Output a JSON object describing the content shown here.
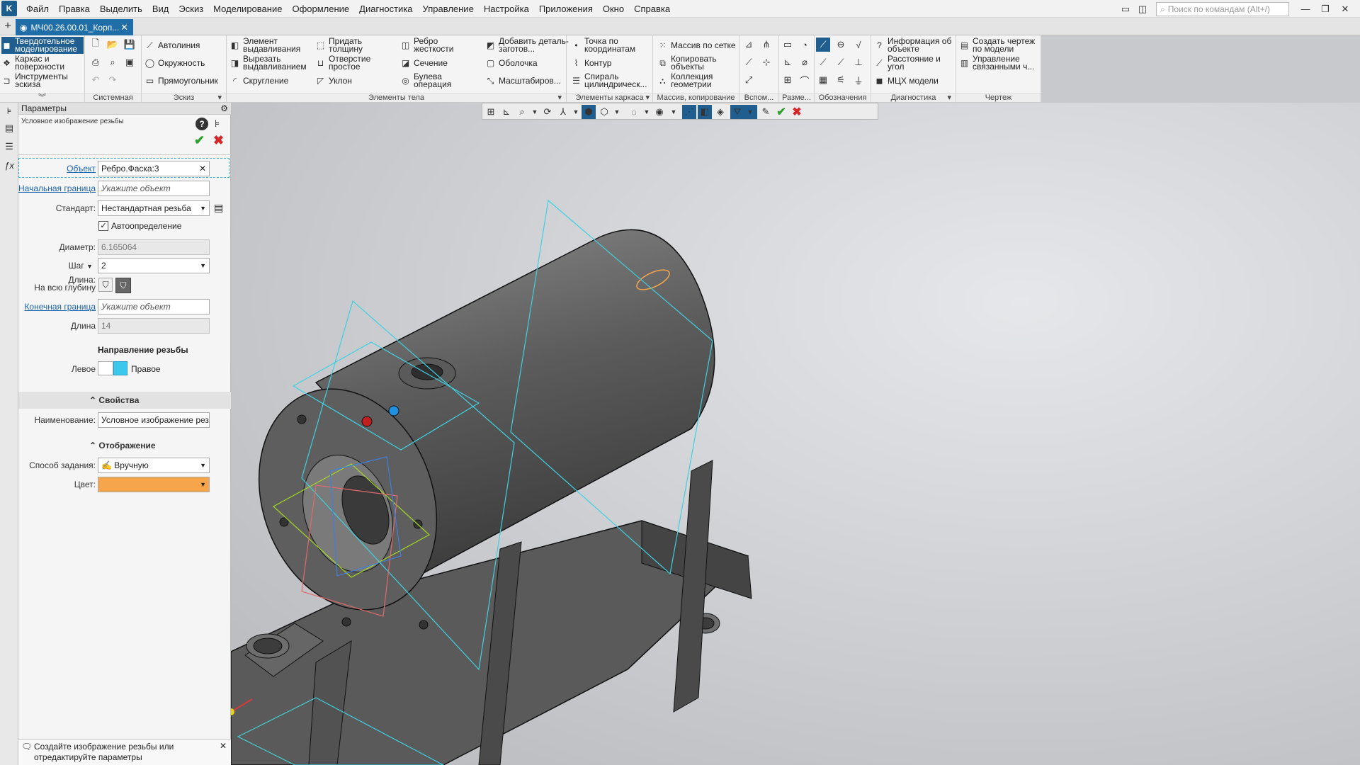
{
  "menubar": {
    "items": [
      "Файл",
      "Правка",
      "Выделить",
      "Вид",
      "Эскиз",
      "Моделирование",
      "Оформление",
      "Диагностика",
      "Управление",
      "Настройка",
      "Приложения",
      "Окно",
      "Справка"
    ],
    "search_placeholder": "Поиск по командам (Alt+/)"
  },
  "tabs": {
    "doc_title": "МЧ00.26.00.01_Корп..."
  },
  "ribbon": {
    "modes": [
      "Твердотельное моделирование",
      "Каркас и поверхности",
      "Инструменты эскиза"
    ],
    "groups": {
      "system": "Системная",
      "sketch": "Эскиз",
      "body": "Элементы тела",
      "frame": "Элементы каркаса",
      "array": "Массив, копирование",
      "aux": "Вспом...",
      "dims": "Разме...",
      "marks": "Обозначения",
      "diag": "Диагностика",
      "drawing": "Чертеж"
    },
    "sketch_buttons": [
      "Автолиния",
      "Окружность",
      "Прямоугольник"
    ],
    "body_buttons_col1": [
      "Элемент выдавливания",
      "Вырезать выдавливанием",
      "Скругление"
    ],
    "body_buttons_col2": [
      "Придать толщину",
      "Отверстие простое",
      "Уклон"
    ],
    "body_buttons_col3": [
      "Ребро жесткости",
      "Сечение",
      "Булева операция"
    ],
    "body_buttons_col4": [
      "Добавить деталь-заготов...",
      "Оболочка",
      "Масштабиров..."
    ],
    "frame_buttons": [
      "Точка по координатам",
      "Контур",
      "Спираль цилиндрическ..."
    ],
    "array_buttons": [
      "Массив по сетке",
      "Копировать объекты",
      "Коллекция геометрии"
    ],
    "diag_buttons": [
      "Информация об объекте",
      "Расстояние и угол",
      "МЦХ модели"
    ],
    "drawing_buttons": [
      "Создать чертеж по модели",
      "Управление связанными ч..."
    ]
  },
  "panel": {
    "header": "Параметры",
    "subtitle": "Условное изображение резьбы",
    "object_label": "Объект",
    "object_value": "Ребро.Фаска:3",
    "start_label": "Начальная граница",
    "start_placeholder": "Укажите объект",
    "standard_label": "Стандарт:",
    "standard_value": "Нестандартная резьба",
    "auto_label": "Автоопределение",
    "diameter_label": "Диаметр:",
    "diameter_value": "6.165064",
    "step_label": "Шаг",
    "step_value": "2",
    "length_label": "Длина:",
    "length_sub": "На всю глубину",
    "end_label": "Конечная граница",
    "end_placeholder": "Укажите объект",
    "length2_label": "Длина",
    "length2_value": "14",
    "direction_title": "Направление резьбы",
    "left_label": "Левое",
    "right_label": "Правое",
    "props_title": "Свойства",
    "name_label": "Наименование:",
    "name_value": "Условное изображение резьбы",
    "display_title": "Отображение",
    "method_label": "Способ задания:",
    "method_value": "Вручную",
    "color_label": "Цвет:",
    "color_hex": "#f6a54a",
    "direction_color": "#3ac8ec"
  },
  "hint": {
    "text": "Создайте изображение резьбы или отредактируйте параметры"
  },
  "colors": {
    "accent": "#1f6ea8",
    "construct_planes": "#3fd0e0",
    "thread_color": "#f6a54a"
  }
}
